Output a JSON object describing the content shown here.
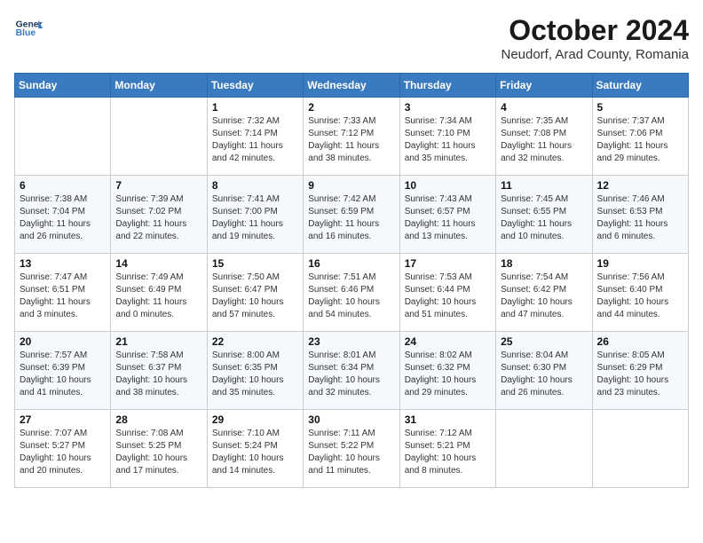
{
  "header": {
    "logo_line1": "General",
    "logo_line2": "Blue",
    "month": "October 2024",
    "location": "Neudorf, Arad County, Romania"
  },
  "weekdays": [
    "Sunday",
    "Monday",
    "Tuesday",
    "Wednesday",
    "Thursday",
    "Friday",
    "Saturday"
  ],
  "weeks": [
    [
      {
        "day": "",
        "info": ""
      },
      {
        "day": "",
        "info": ""
      },
      {
        "day": "1",
        "info": "Sunrise: 7:32 AM\nSunset: 7:14 PM\nDaylight: 11 hours and 42 minutes."
      },
      {
        "day": "2",
        "info": "Sunrise: 7:33 AM\nSunset: 7:12 PM\nDaylight: 11 hours and 38 minutes."
      },
      {
        "day": "3",
        "info": "Sunrise: 7:34 AM\nSunset: 7:10 PM\nDaylight: 11 hours and 35 minutes."
      },
      {
        "day": "4",
        "info": "Sunrise: 7:35 AM\nSunset: 7:08 PM\nDaylight: 11 hours and 32 minutes."
      },
      {
        "day": "5",
        "info": "Sunrise: 7:37 AM\nSunset: 7:06 PM\nDaylight: 11 hours and 29 minutes."
      }
    ],
    [
      {
        "day": "6",
        "info": "Sunrise: 7:38 AM\nSunset: 7:04 PM\nDaylight: 11 hours and 26 minutes."
      },
      {
        "day": "7",
        "info": "Sunrise: 7:39 AM\nSunset: 7:02 PM\nDaylight: 11 hours and 22 minutes."
      },
      {
        "day": "8",
        "info": "Sunrise: 7:41 AM\nSunset: 7:00 PM\nDaylight: 11 hours and 19 minutes."
      },
      {
        "day": "9",
        "info": "Sunrise: 7:42 AM\nSunset: 6:59 PM\nDaylight: 11 hours and 16 minutes."
      },
      {
        "day": "10",
        "info": "Sunrise: 7:43 AM\nSunset: 6:57 PM\nDaylight: 11 hours and 13 minutes."
      },
      {
        "day": "11",
        "info": "Sunrise: 7:45 AM\nSunset: 6:55 PM\nDaylight: 11 hours and 10 minutes."
      },
      {
        "day": "12",
        "info": "Sunrise: 7:46 AM\nSunset: 6:53 PM\nDaylight: 11 hours and 6 minutes."
      }
    ],
    [
      {
        "day": "13",
        "info": "Sunrise: 7:47 AM\nSunset: 6:51 PM\nDaylight: 11 hours and 3 minutes."
      },
      {
        "day": "14",
        "info": "Sunrise: 7:49 AM\nSunset: 6:49 PM\nDaylight: 11 hours and 0 minutes."
      },
      {
        "day": "15",
        "info": "Sunrise: 7:50 AM\nSunset: 6:47 PM\nDaylight: 10 hours and 57 minutes."
      },
      {
        "day": "16",
        "info": "Sunrise: 7:51 AM\nSunset: 6:46 PM\nDaylight: 10 hours and 54 minutes."
      },
      {
        "day": "17",
        "info": "Sunrise: 7:53 AM\nSunset: 6:44 PM\nDaylight: 10 hours and 51 minutes."
      },
      {
        "day": "18",
        "info": "Sunrise: 7:54 AM\nSunset: 6:42 PM\nDaylight: 10 hours and 47 minutes."
      },
      {
        "day": "19",
        "info": "Sunrise: 7:56 AM\nSunset: 6:40 PM\nDaylight: 10 hours and 44 minutes."
      }
    ],
    [
      {
        "day": "20",
        "info": "Sunrise: 7:57 AM\nSunset: 6:39 PM\nDaylight: 10 hours and 41 minutes."
      },
      {
        "day": "21",
        "info": "Sunrise: 7:58 AM\nSunset: 6:37 PM\nDaylight: 10 hours and 38 minutes."
      },
      {
        "day": "22",
        "info": "Sunrise: 8:00 AM\nSunset: 6:35 PM\nDaylight: 10 hours and 35 minutes."
      },
      {
        "day": "23",
        "info": "Sunrise: 8:01 AM\nSunset: 6:34 PM\nDaylight: 10 hours and 32 minutes."
      },
      {
        "day": "24",
        "info": "Sunrise: 8:02 AM\nSunset: 6:32 PM\nDaylight: 10 hours and 29 minutes."
      },
      {
        "day": "25",
        "info": "Sunrise: 8:04 AM\nSunset: 6:30 PM\nDaylight: 10 hours and 26 minutes."
      },
      {
        "day": "26",
        "info": "Sunrise: 8:05 AM\nSunset: 6:29 PM\nDaylight: 10 hours and 23 minutes."
      }
    ],
    [
      {
        "day": "27",
        "info": "Sunrise: 7:07 AM\nSunset: 5:27 PM\nDaylight: 10 hours and 20 minutes."
      },
      {
        "day": "28",
        "info": "Sunrise: 7:08 AM\nSunset: 5:25 PM\nDaylight: 10 hours and 17 minutes."
      },
      {
        "day": "29",
        "info": "Sunrise: 7:10 AM\nSunset: 5:24 PM\nDaylight: 10 hours and 14 minutes."
      },
      {
        "day": "30",
        "info": "Sunrise: 7:11 AM\nSunset: 5:22 PM\nDaylight: 10 hours and 11 minutes."
      },
      {
        "day": "31",
        "info": "Sunrise: 7:12 AM\nSunset: 5:21 PM\nDaylight: 10 hours and 8 minutes."
      },
      {
        "day": "",
        "info": ""
      },
      {
        "day": "",
        "info": ""
      }
    ]
  ]
}
